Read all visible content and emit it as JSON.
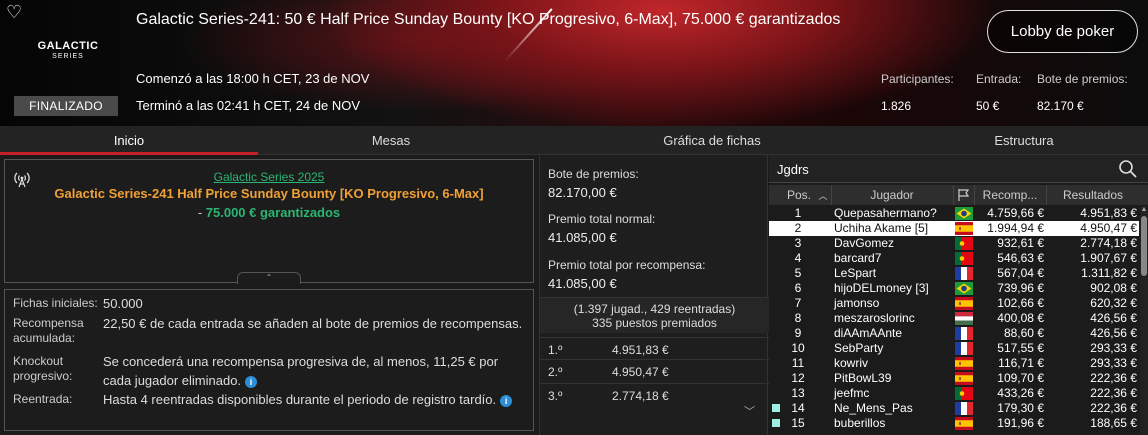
{
  "header": {
    "title": "Galactic Series-241: 50 € Half Price Sunday Bounty [KO Progresivo, 6-Max], 75.000 € garantizados",
    "logo_line1": "GALACTIC",
    "logo_line2": "SERIES",
    "lobby_button": "Lobby de poker",
    "started": "Comenzó a las 18:00 h CET, 23 de NOV",
    "ended": "Terminó a las 02:41 h CET, 24 de NOV",
    "status": "FINALIZADO",
    "stats": {
      "participants_label": "Participantes:",
      "participants_value": "1.826",
      "entry_label": "Entrada:",
      "entry_value": "50 €",
      "prize_label": "Bote de premios:",
      "prize_value": "82.170 €"
    }
  },
  "tabs": [
    {
      "label": "Inicio",
      "active": true
    },
    {
      "label": "Mesas",
      "active": false
    },
    {
      "label": "Gráfica de fichas",
      "active": false
    },
    {
      "label": "Estructura",
      "active": false
    }
  ],
  "info": {
    "series_link": "Galactic Series 2025",
    "event_title": "Galactic Series-241 Half Price Sunday Bounty [KO Progresivo, 6-Max]",
    "guaranteed_prefix": "- ",
    "guaranteed": "75.000 € garantizados"
  },
  "details": [
    {
      "label": "Fichas iniciales:",
      "value": "50.000"
    },
    {
      "label": "Recompensa acumulada:",
      "value": "22,50 € de cada entrada se añaden al bote de premios de recompensas."
    },
    {
      "label": "Knockout progresivo:",
      "value": "Se concederá una recompensa progresiva de, al menos, 11,25 € por cada jugador eliminado."
    },
    {
      "label": "Reentrada:",
      "value": "Hasta 4 reentradas disponibles durante el periodo de registro tardío."
    }
  ],
  "prizes": {
    "pool_label": "Bote de premios:",
    "pool_value": "82.170,00 €",
    "normal_label": "Premio total normal:",
    "normal_value": "41.085,00 €",
    "bounty_label": "Premio total por recompensa:",
    "bounty_value": "41.085,00 €",
    "players_summary": "(1.397 jugad., 429 reentradas)",
    "paid_summary": "335 puestos premiados",
    "places": [
      {
        "pos": "1.º",
        "amount": "4.951,83 €"
      },
      {
        "pos": "2.º",
        "amount": "4.950,47 €"
      },
      {
        "pos": "3.º",
        "amount": "2.774,18 €"
      }
    ]
  },
  "ranking": {
    "search_value": "Jgdrs",
    "columns": {
      "pos": "Pos.",
      "player": "Jugador",
      "bounty": "Recomp...",
      "results": "Resultados"
    },
    "rows": [
      {
        "pos": "1",
        "name": "Quepasahermano?",
        "flag": "br",
        "bounty": "4.759,66 €",
        "result": "4.951,83 €"
      },
      {
        "pos": "2",
        "name": "Uchiha Akame [5]",
        "flag": "es",
        "bounty": "1.994,94 €",
        "result": "4.950,47 €",
        "selected": true
      },
      {
        "pos": "3",
        "name": "DavGomez",
        "flag": "pt",
        "bounty": "932,61 €",
        "result": "2.774,18 €"
      },
      {
        "pos": "4",
        "name": "barcard7",
        "flag": "pt",
        "bounty": "546,63 €",
        "result": "1.907,67 €"
      },
      {
        "pos": "5",
        "name": "LeSpart",
        "flag": "fr",
        "bounty": "567,04 €",
        "result": "1.311,82 €"
      },
      {
        "pos": "6",
        "name": "hijoDELmoney [3]",
        "flag": "br",
        "bounty": "739,96 €",
        "result": "902,08 €"
      },
      {
        "pos": "7",
        "name": "jamonso",
        "flag": "es",
        "bounty": "102,66 €",
        "result": "620,32 €"
      },
      {
        "pos": "8",
        "name": "meszaroslorinc",
        "flag": "hu",
        "bounty": "400,08 €",
        "result": "426,56 €"
      },
      {
        "pos": "9",
        "name": "diAAmAAnte",
        "flag": "fr",
        "bounty": "88,60 €",
        "result": "426,56 €"
      },
      {
        "pos": "10",
        "name": "SebParty",
        "flag": "fr",
        "bounty": "517,55 €",
        "result": "293,33 €"
      },
      {
        "pos": "11",
        "name": "kowriv",
        "flag": "es",
        "bounty": "116,71 €",
        "result": "293,33 €"
      },
      {
        "pos": "12",
        "name": "PitBowL39",
        "flag": "es",
        "bounty": "109,70 €",
        "result": "222,36 €"
      },
      {
        "pos": "13",
        "name": "jeefmc",
        "flag": "pt",
        "bounty": "433,26 €",
        "result": "222,36 €"
      },
      {
        "pos": "14",
        "name": "Ne_Mens_Pas",
        "flag": "fr",
        "bounty": "179,30 €",
        "result": "222,36 €",
        "mark": true
      },
      {
        "pos": "15",
        "name": "buberillos",
        "flag": "es",
        "bounty": "191,96 €",
        "result": "188,65 €",
        "mark": true
      }
    ]
  },
  "colors": {
    "accent": "#c8202a",
    "link": "#2bb673",
    "event_title": "#f0a035",
    "info_dot": "#2a8fd6"
  }
}
